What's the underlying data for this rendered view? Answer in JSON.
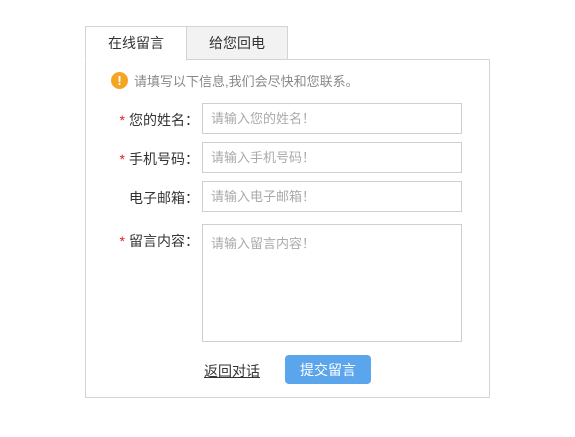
{
  "tabs": [
    {
      "label": "在线留言",
      "active": true
    },
    {
      "label": "给您回电",
      "active": false
    }
  ],
  "notice": {
    "icon": "exclamation-icon",
    "text": "请填写以下信息,我们会尽快和您联系。"
  },
  "form": {
    "name": {
      "required": true,
      "label": "您的姓名：",
      "placeholder": "请输入您的姓名！",
      "value": ""
    },
    "phone": {
      "required": true,
      "label": "手机号码：",
      "placeholder": "请输入手机号码！",
      "value": ""
    },
    "email": {
      "required": false,
      "label": "电子邮箱：",
      "placeholder": "请输入电子邮箱！",
      "value": ""
    },
    "message": {
      "required": true,
      "label": "留言内容：",
      "placeholder": "请输入留言内容！",
      "value": ""
    },
    "required_mark": "*"
  },
  "actions": {
    "back_label": "返回对话",
    "submit_label": "提交留言"
  },
  "colors": {
    "accent": "#5aa5ec",
    "notice": "#f4a623",
    "required": "#e02020"
  }
}
